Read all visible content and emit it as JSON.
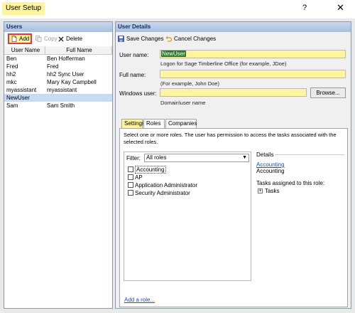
{
  "window": {
    "title": "User Setup",
    "help": "?",
    "close": "✕"
  },
  "users_panel": {
    "title": "Users",
    "toolbar": {
      "add": "Add",
      "copy": "Copy",
      "delete": "Delete"
    },
    "columns": [
      "User Name",
      "Full Name"
    ],
    "rows": [
      {
        "user": "Ben",
        "full": "Ben Hofferman"
      },
      {
        "user": "Fred",
        "full": "Fred"
      },
      {
        "user": "hh2",
        "full": "hh2 Sync User"
      },
      {
        "user": "mkc",
        "full": "Mary Kay Campbell"
      },
      {
        "user": "myassistant",
        "full": "myassistant"
      },
      {
        "user": "NewUser",
        "full": ""
      },
      {
        "user": "Sam",
        "full": "Sam Smith"
      }
    ],
    "selected_index": 5
  },
  "details_panel": {
    "title": "User Details",
    "toolbar": {
      "save": "Save Changes",
      "cancel": "Cancel Changes"
    },
    "form": {
      "user_name_label": "User name:",
      "user_name_value": "NewUser",
      "user_name_hint": "Logon for Sage Timberline Office (for example, JDoe)",
      "full_name_label": "Full name:",
      "full_name_value": "",
      "full_name_hint": "(For example, John Doe)",
      "windows_user_label": "Windows user:",
      "windows_user_value": "",
      "windows_user_hint": "Domain\\user name",
      "browse": "Browse..."
    },
    "tabs": [
      {
        "label": "Settings"
      },
      {
        "label": "Roles"
      },
      {
        "label": "Companies"
      }
    ],
    "active_tab": "Roles",
    "roles": {
      "description": "Select one or more roles. The user has permission to access the tasks associated with the selected roles.",
      "filter_label": "Filter:",
      "filter_value": "All roles",
      "items": [
        {
          "label": "Accounting",
          "checked": false
        },
        {
          "label": "AP",
          "checked": false
        },
        {
          "label": "Application Administrator",
          "checked": false
        },
        {
          "label": "Security Administrator",
          "checked": false
        }
      ],
      "add_role": "Add a role...",
      "details": {
        "title": "Details",
        "link": "Accounting",
        "name": "Accounting",
        "tasks_label": "Tasks assigned to this role:",
        "tasks_node": "Tasks",
        "expander": "+"
      }
    }
  },
  "colors": {
    "highlight": "#fff59d",
    "header_gradient_top": "#c9d8ec",
    "header_text": "#0f2f66",
    "selected_row": "#c7dcf3",
    "link": "#1a4fb5",
    "add_border": "#e53935"
  }
}
